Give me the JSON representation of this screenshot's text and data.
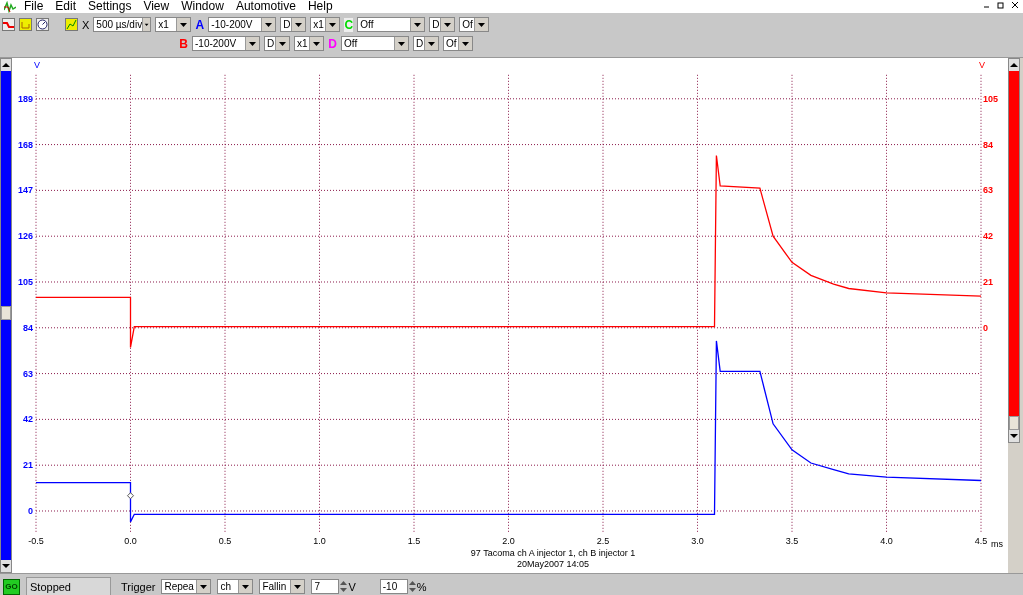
{
  "menu": [
    "File",
    "Edit",
    "Settings",
    "View",
    "Window",
    "Automotive",
    "Help"
  ],
  "toolbar": {
    "timebase_label": "X",
    "timebase": "500 µs/div",
    "timebase_mult": "x1",
    "channels": [
      {
        "letter": "A",
        "color": "#0000ff",
        "range": "-10-200V",
        "coupling": "D",
        "mult": "x1"
      },
      {
        "letter": "B",
        "color": "#ff0000",
        "range": "-10-200V",
        "coupling": "D",
        "mult": "x1"
      },
      {
        "letter": "C",
        "color": "#00dd00",
        "range": "Off",
        "coupling": "D",
        "mult": "Of"
      },
      {
        "letter": "D",
        "color": "#ff00ff",
        "range": "Off",
        "coupling": "D",
        "mult": "Of"
      }
    ]
  },
  "chart": {
    "left_unit": "V",
    "right_unit": "V",
    "x_unit": "ms",
    "caption": [
      "97 Tacoma ch A injector 1, ch B injector 1",
      "20May2007  14:05"
    ],
    "chart_data": {
      "type": "line",
      "x": [
        -0.5,
        0,
        0,
        0.02,
        3.09,
        3.1,
        3.12,
        3.33,
        3.4,
        3.5,
        3.6,
        3.72,
        3.8,
        4.0,
        4.5
      ],
      "xlim": [
        -0.5,
        4.5
      ],
      "xticks": [
        -0.5,
        {
          "value": 0,
          "label": "0.0"
        },
        0.5,
        {
          "value": 1,
          "label": "1.0"
        },
        1.5,
        {
          "value": 2,
          "label": "2.0"
        },
        2.5,
        {
          "value": 3,
          "label": "3.0"
        },
        3.5,
        {
          "value": 4,
          "label": "4.0"
        },
        4.5
      ],
      "ylim": [
        -10,
        200
      ],
      "y2lim": [
        -94,
        116
      ],
      "y2ticks": [
        0,
        21,
        42,
        63,
        84,
        105
      ],
      "grid": true,
      "yticks": [
        0,
        21,
        42,
        63,
        84,
        105,
        126,
        147,
        168,
        189
      ],
      "series": [
        {
          "color": "#0000ff",
          "values": [
            13,
            13,
            -5,
            -1.5,
            -1.5,
            78,
            64,
            64,
            40,
            28,
            22,
            19,
            17,
            15.5,
            14
          ]
        },
        {
          "color": "#ff0000",
          "axis": "y2",
          "values": [
            14,
            14,
            -9,
            0.5,
            0.5,
            79,
            65,
            64,
            42,
            30,
            24,
            20,
            18,
            16,
            14.5
          ]
        }
      ]
    }
  },
  "status_bar": {
    "go_label": "GO",
    "state": "Stopped",
    "trigger_label": "Trigger",
    "mode": "Repea",
    "source": "ch",
    "edge": "Fallin",
    "threshold": "7",
    "threshold_unit": "V",
    "pretrigger": "-10",
    "pretrigger_unit": "%"
  }
}
